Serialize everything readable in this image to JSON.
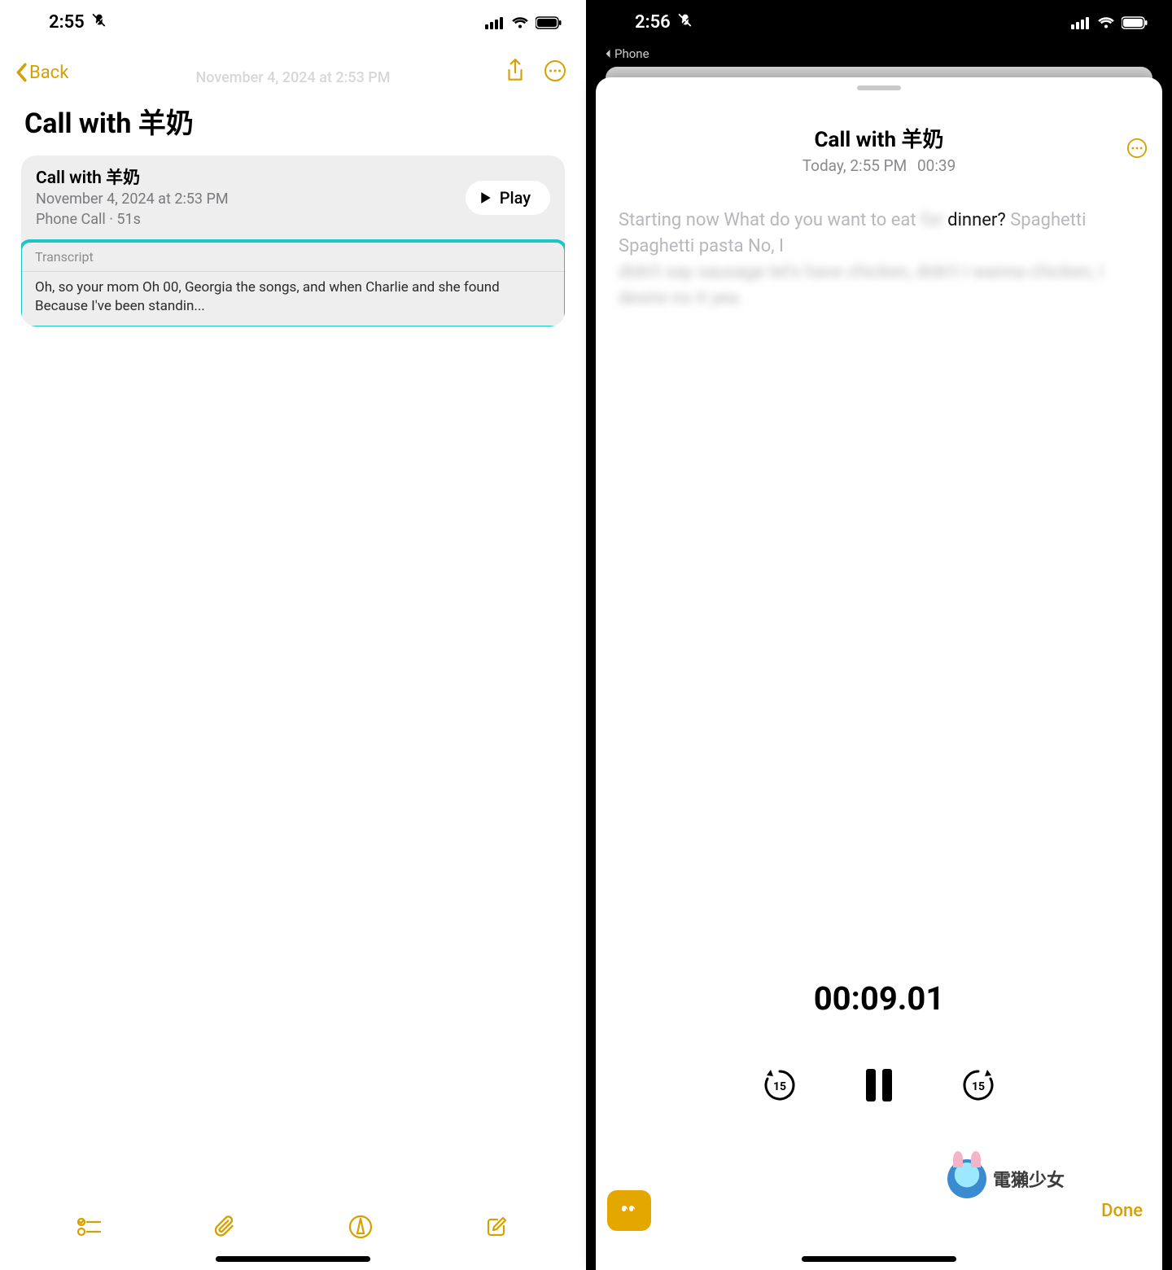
{
  "left": {
    "status": {
      "time": "2:55"
    },
    "nav": {
      "back": "Back"
    },
    "faded_date": "November 4, 2024 at 2:53 PM",
    "title": "Call with 羊奶",
    "card": {
      "title": "Call with 羊奶",
      "date": "November 4, 2024 at 2:53 PM",
      "meta": "Phone Call · 51s",
      "play": "Play",
      "transcript_label": "Transcript",
      "transcript_body": "Oh, so your mom Oh 00, Georgia the songs, and when Charlie and she found  Because I've been standin..."
    }
  },
  "right": {
    "status": {
      "time": "2:56"
    },
    "back_to_phone": "Phone",
    "sheet": {
      "title": "Call with 羊奶",
      "subtitle_date": "Today, 2:55 PM",
      "subtitle_dur": "00:39",
      "transcript_gray1": "Starting now What do you want to eat ",
      "transcript_blur1": "for",
      "transcript_black": "dinner?",
      "transcript_gray2": " Spaghetti Spaghetti pasta No, I",
      "transcript_blur2": "didn't say sausage let's have chicken, didn't I wanna chicken, I desire no it yea.",
      "timer": "00:09.01",
      "done": "Done"
    }
  },
  "watermark": "電獺少女"
}
